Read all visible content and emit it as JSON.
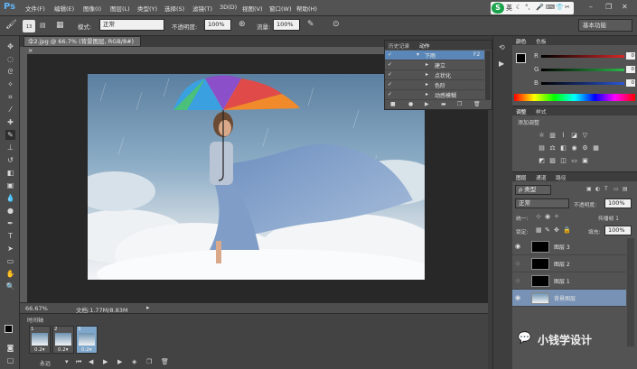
{
  "app": {
    "logo": "Ps"
  },
  "menu": [
    "文件(F)",
    "编辑(E)",
    "图像(I)",
    "图层(L)",
    "类型(Y)",
    "选择(S)",
    "滤镜(T)",
    "3D(D)",
    "视图(V)",
    "窗口(W)",
    "帮助(H)"
  ],
  "ime": {
    "badge": "S",
    "lang": "英"
  },
  "options": {
    "brush_size": "13",
    "mode_label": "模式:",
    "mode_value": "正常",
    "opacity_label": "不透明度:",
    "opacity_value": "100%",
    "flow_label": "流量:",
    "flow_value": "100%",
    "workspace": "基本功能"
  },
  "document": {
    "tab_title": "伞2.jpg @ 66.7% (背景图层, RGB/8#) ×",
    "zoom": "66.67%",
    "doc_info": "文档:1.77M/8.83M"
  },
  "timeline": {
    "title": "时间轴",
    "frames": [
      {
        "num": "1",
        "delay": "0.2▾"
      },
      {
        "num": "2",
        "delay": "0.2▾"
      },
      {
        "num": "3",
        "delay": "0.2▾"
      }
    ],
    "loop": "永远"
  },
  "actions_panel": {
    "tabs": [
      "历史记录",
      "动作"
    ],
    "rows": [
      {
        "label": "下雨",
        "shortcut": "F2"
      },
      {
        "label": "建立"
      },
      {
        "label": "点状化"
      },
      {
        "label": "色阶"
      },
      {
        "label": "动感模糊"
      }
    ]
  },
  "color_panel": {
    "tabs": [
      "颜色",
      "色板"
    ],
    "channels": [
      {
        "label": "R",
        "value": "0",
        "color": "#d62828"
      },
      {
        "label": "G",
        "value": "0",
        "color": "#2db84a"
      },
      {
        "label": "B",
        "value": "0",
        "color": "#2c55d6"
      }
    ]
  },
  "adjustments_panel": {
    "tabs": [
      "调整",
      "样式"
    ],
    "title": "添加调整"
  },
  "layers_panel": {
    "tabs": [
      "图层",
      "通道",
      "路径"
    ],
    "filter_kind": "ρ 类型",
    "blend_mode": "正常",
    "opacity_label": "不透明度:",
    "opacity_value": "100%",
    "lock_label": "锁定:",
    "fill_label": "填充:",
    "fill_value": "100%",
    "unify_label": "统一:",
    "propagate_label": "传播帧 1",
    "layers": [
      {
        "name": "图层 3",
        "visible": true
      },
      {
        "name": "图层 2",
        "visible": false
      },
      {
        "name": "图层 1",
        "visible": false
      },
      {
        "name": "背景图层",
        "visible": true
      }
    ]
  },
  "watermark": {
    "text": "小钱学设计"
  }
}
